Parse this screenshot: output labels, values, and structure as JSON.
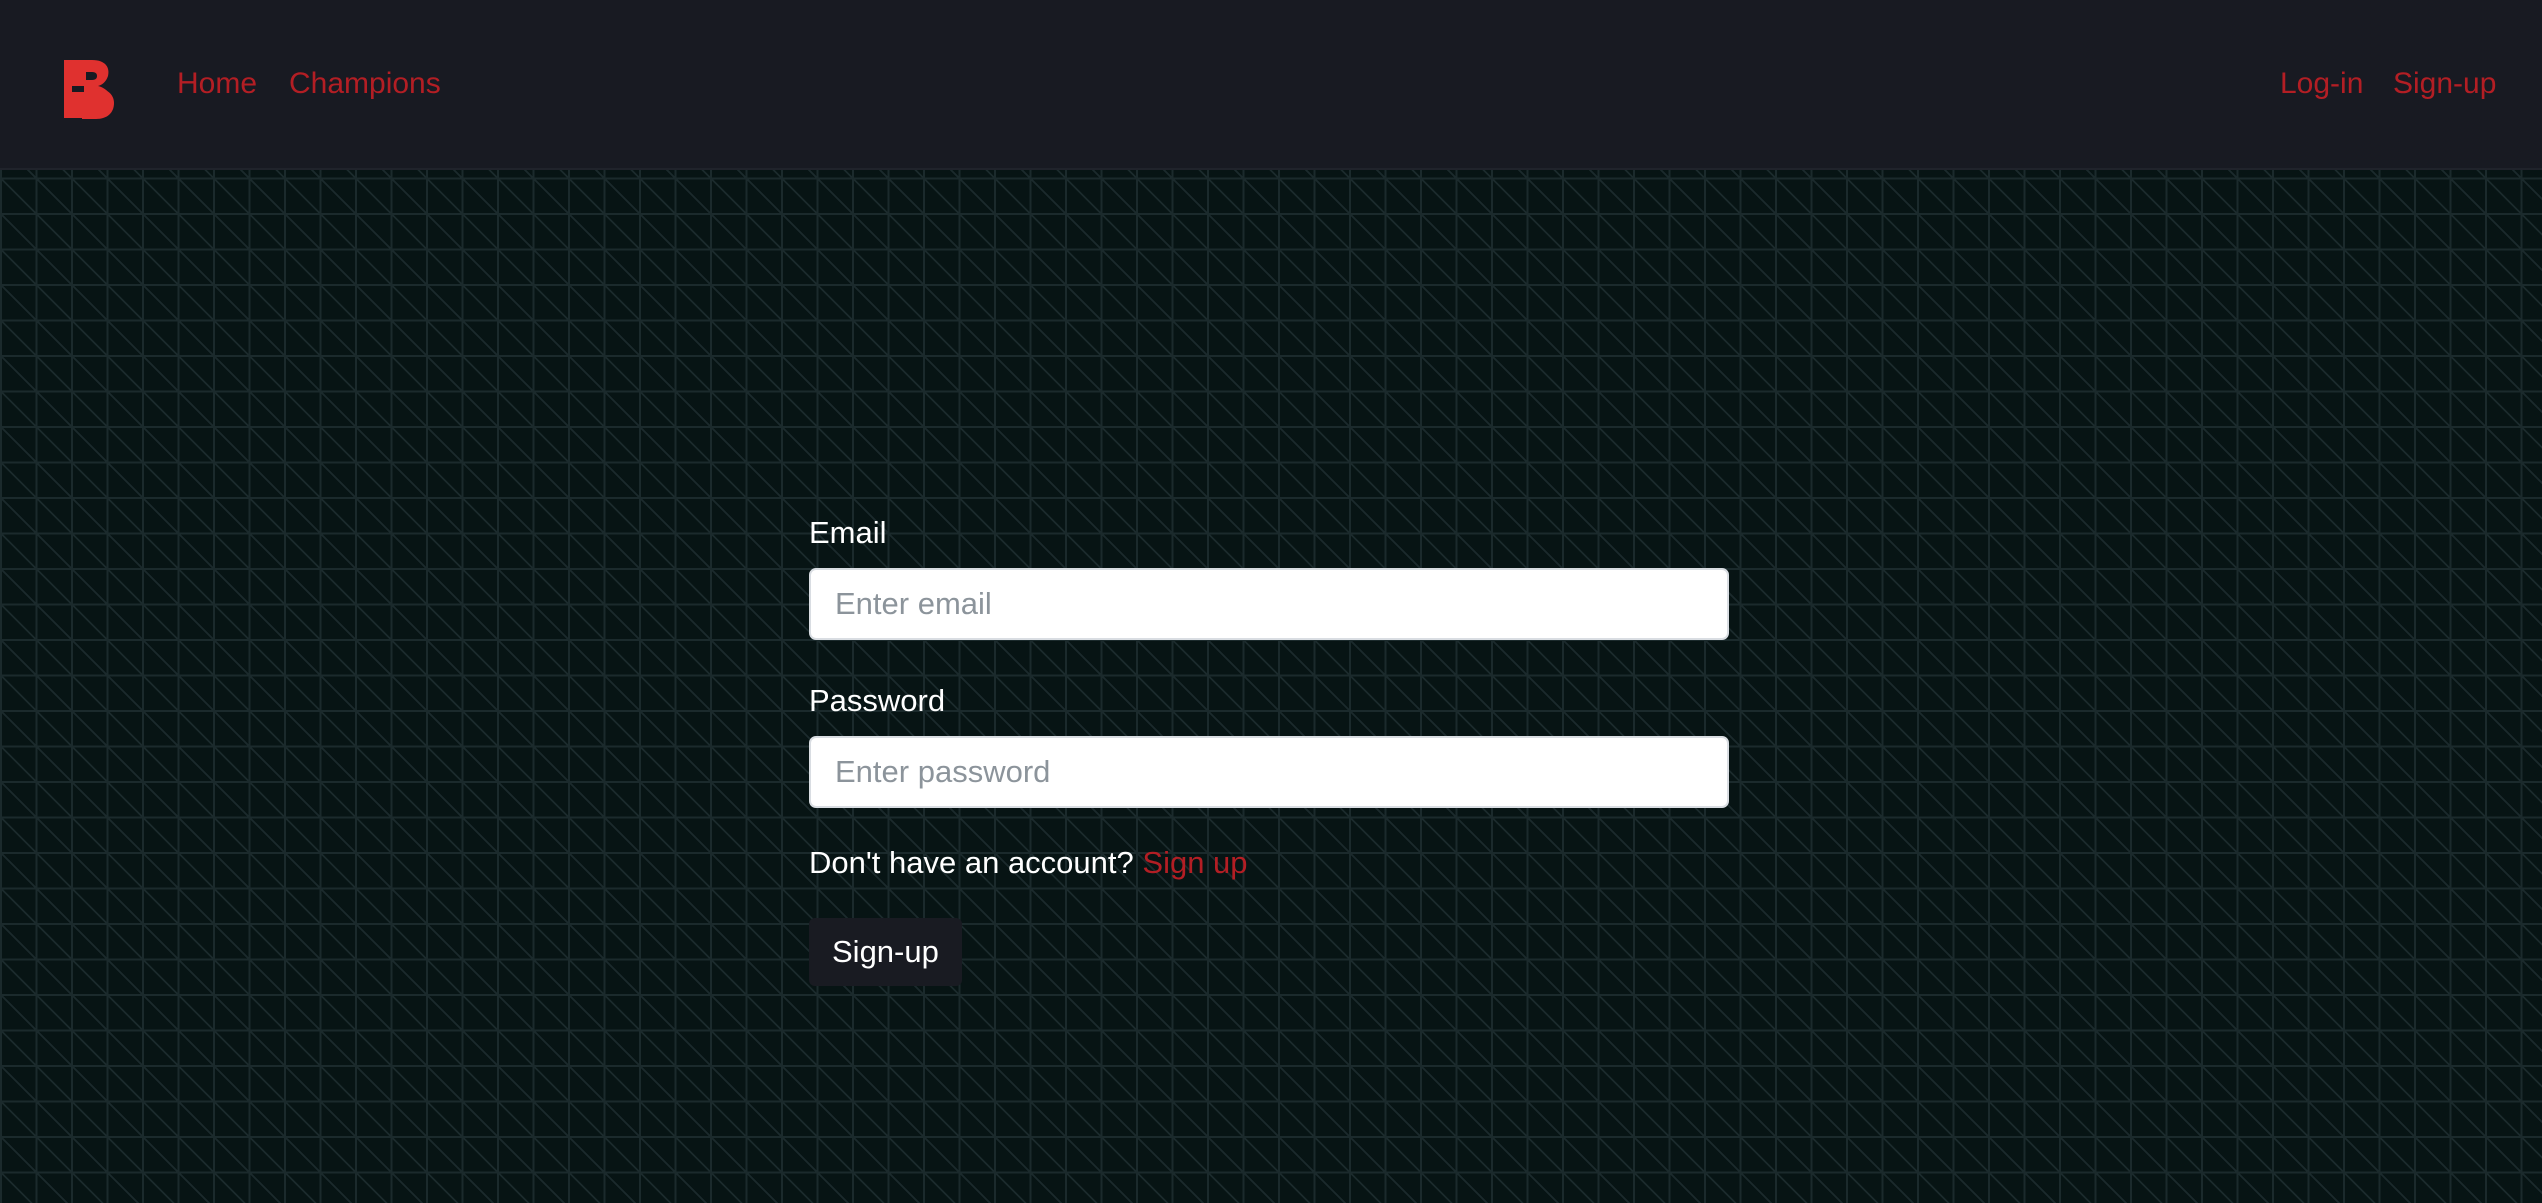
{
  "navbar": {
    "logo_icon": "brand-logo-icon",
    "links_left": [
      "Home",
      "Champions"
    ],
    "links_right": [
      "Log-in",
      "Sign-up"
    ],
    "accent_color": "#b31e24"
  },
  "form": {
    "email_label": "Email",
    "email_placeholder": "Enter email",
    "email_value": "",
    "password_label": "Password",
    "password_placeholder": "Enter password",
    "password_value": "",
    "account_prompt": "Don't have an account?",
    "signup_link": "Sign up",
    "submit_label": "Sign-up"
  }
}
